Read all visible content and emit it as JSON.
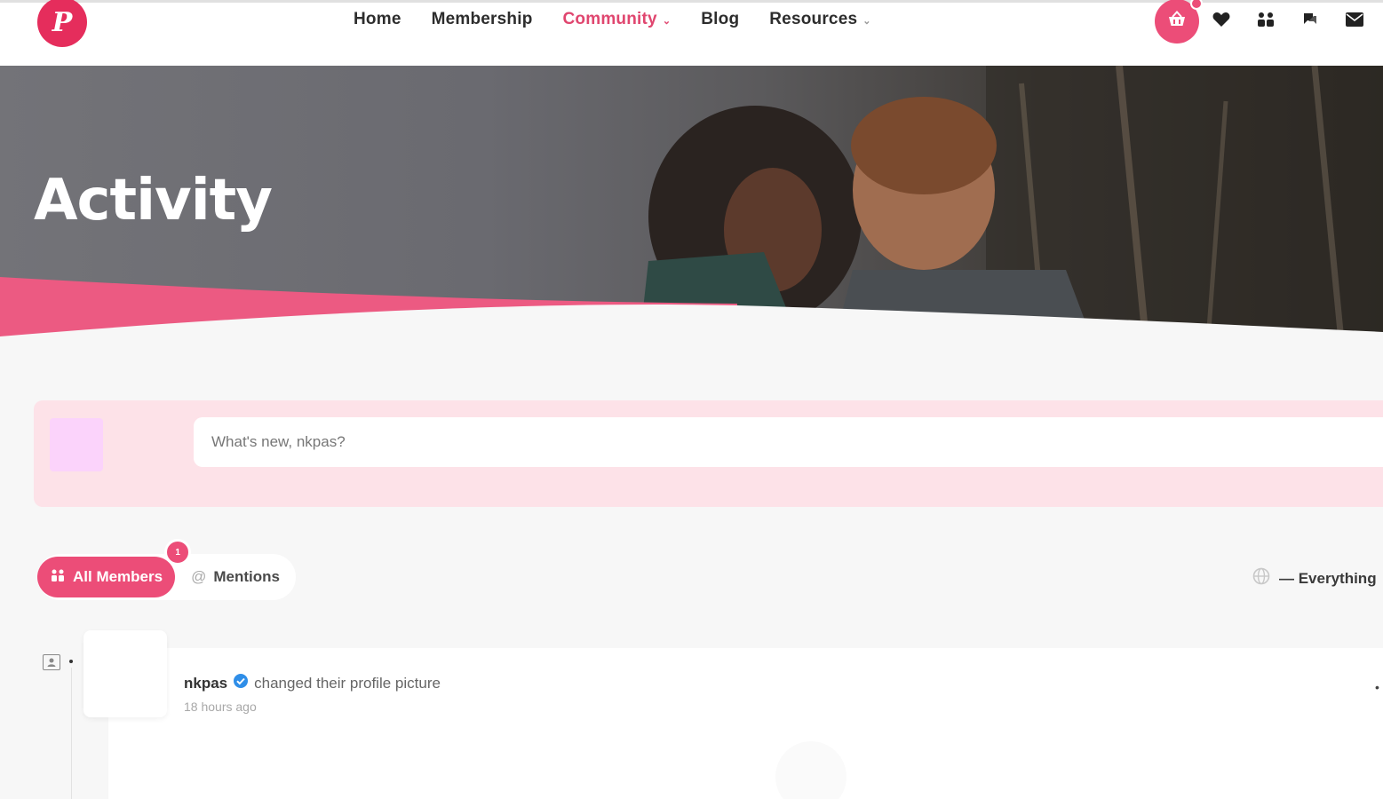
{
  "header": {
    "logo_letter": "P",
    "nav": [
      {
        "label": "Home",
        "active": false,
        "dropdown": false
      },
      {
        "label": "Membership",
        "active": false,
        "dropdown": false
      },
      {
        "label": "Community",
        "active": true,
        "dropdown": true
      },
      {
        "label": "Blog",
        "active": false,
        "dropdown": false
      },
      {
        "label": "Resources",
        "active": false,
        "dropdown": true
      }
    ],
    "icons": [
      "cart-icon",
      "heart-icon",
      "users-icon",
      "chat-icon",
      "mail-icon"
    ]
  },
  "hero": {
    "title": "Activity"
  },
  "composer": {
    "placeholder": "What's new, nkpas?"
  },
  "filters": {
    "all_members_label": "All Members",
    "all_members_badge": "1",
    "mentions_label": "Mentions",
    "right_label": "— Everything"
  },
  "activity": {
    "username": "nkpas",
    "action": "changed their profile picture",
    "time": "18 hours ago"
  },
  "colors": {
    "accent": "#ec4d78",
    "accent_dark": "#e52d5c",
    "composer_bg": "#fde2e8"
  }
}
